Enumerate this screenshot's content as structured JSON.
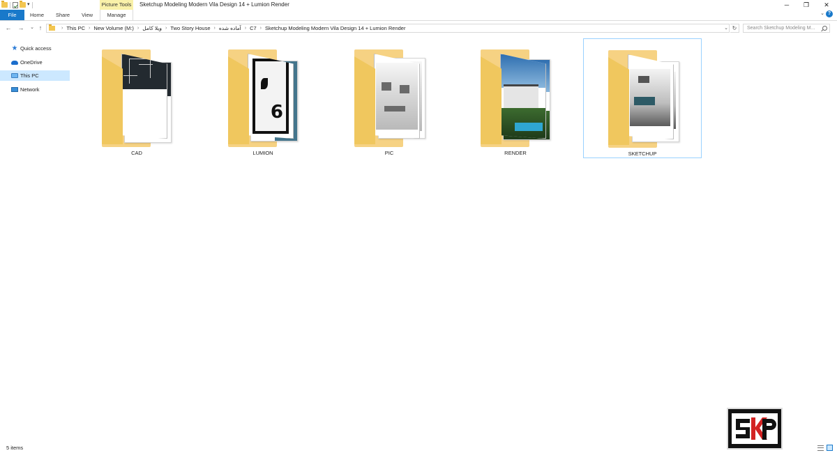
{
  "window": {
    "title": "Sketchup Modeling Modern Vila Design 14 + Lumion Render",
    "context_tab_header": "Picture Tools",
    "controls": {
      "minimize": "─",
      "maximize": "❐",
      "close": "✕"
    }
  },
  "ribbon": {
    "tabs": [
      "File",
      "Home",
      "Share",
      "View",
      "Manage"
    ],
    "collapse_glyph": "⌄",
    "help_glyph": "?"
  },
  "nav": {
    "back": "←",
    "forward": "→",
    "recent": "⌄",
    "up": "↑",
    "breadcrumb": [
      "This PC",
      "New Volume (M:)",
      "ویلا کامل",
      "Two Story House",
      "آماده شده",
      "C7",
      "Sketchup Modeling Modern Vila Design 14 + Lumion Render"
    ],
    "breadcrumb_sep": "›",
    "dropdown_glyph": "⌄",
    "refresh_glyph": "↻",
    "search_placeholder": "Search Sketchup Modeling M..."
  },
  "sidebar": {
    "items": [
      {
        "label": "Quick access",
        "icon": "star-icon",
        "selected": false
      },
      {
        "label": "OneDrive",
        "icon": "cloud-icon",
        "selected": false
      },
      {
        "label": "This PC",
        "icon": "computer-icon",
        "selected": true
      },
      {
        "label": "Network",
        "icon": "network-icon",
        "selected": false
      }
    ]
  },
  "folders": [
    {
      "name": "CAD",
      "selected": false
    },
    {
      "name": "LUMION",
      "selected": false
    },
    {
      "name": "PIC",
      "selected": false
    },
    {
      "name": "RENDER",
      "selected": false
    },
    {
      "name": "SKETCHUP",
      "selected": true
    }
  ],
  "status": {
    "item_count": "5 items"
  },
  "colors": {
    "accent": "#1979ca",
    "selection": "#cce8ff",
    "folder": "#f6d283",
    "context_tab": "#f9f1a9"
  }
}
